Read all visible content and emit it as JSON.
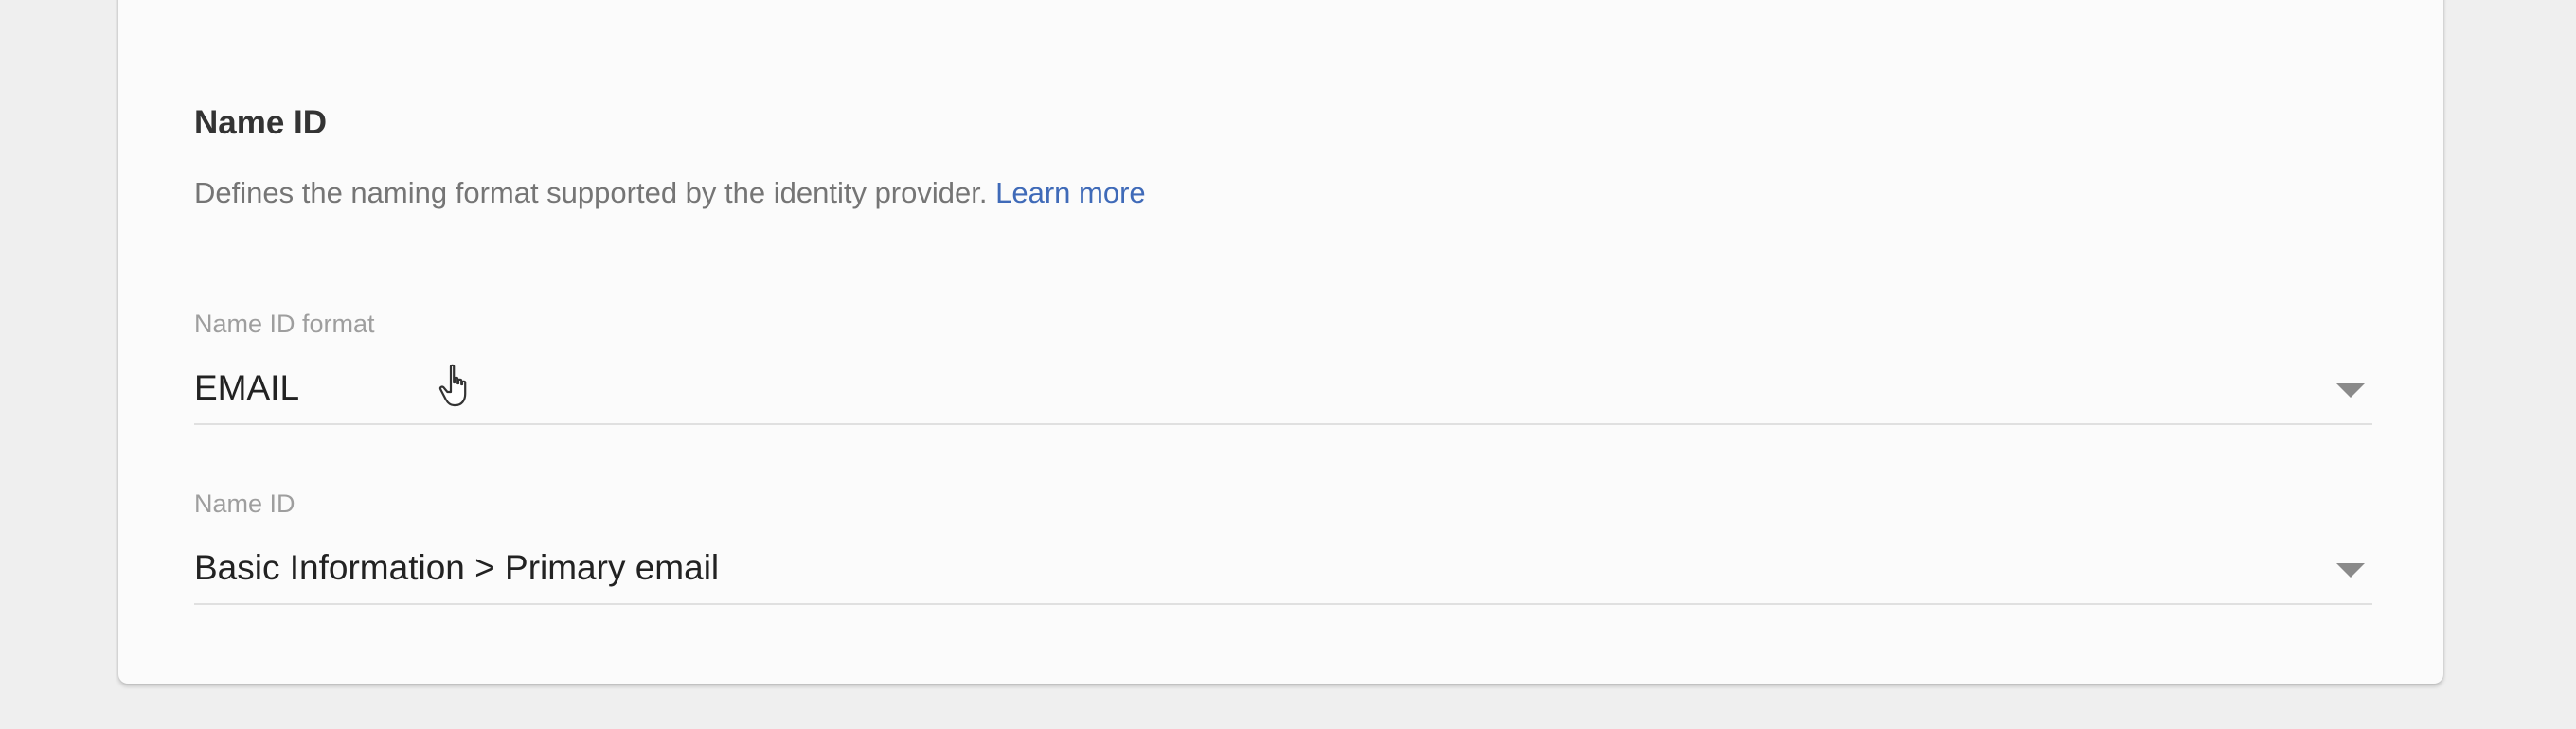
{
  "section": {
    "title": "Name ID",
    "description": "Defines the naming format supported by the identity provider.",
    "learn_more": "Learn more"
  },
  "fields": {
    "name_id_format": {
      "label": "Name ID format",
      "value": "EMAIL",
      "icon": "chevron-down-icon"
    },
    "name_id": {
      "label": "Name ID",
      "value": "Basic Information > Primary email",
      "icon": "chevron-down-icon"
    }
  },
  "colors": {
    "background": "#efefef",
    "card": "#fbfbfb",
    "link": "#3f6ab8",
    "label": "#9e9e9e",
    "text": "#222222"
  },
  "cursor": "hand-pointer-icon"
}
